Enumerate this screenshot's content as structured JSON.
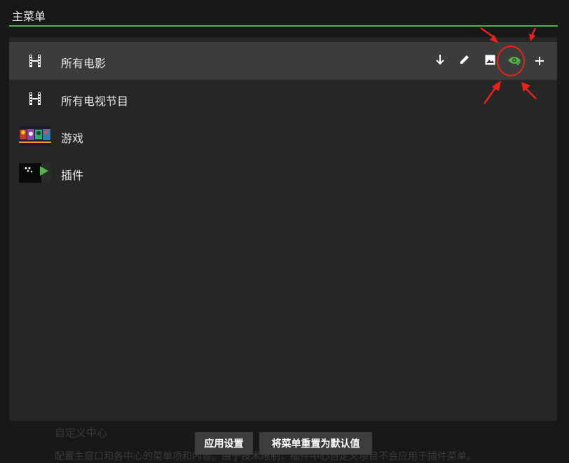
{
  "header": {
    "title": "主菜单"
  },
  "menu_items": [
    {
      "label": "所有电影",
      "icon": "film-icon"
    },
    {
      "label": "所有电视节目",
      "icon": "film-icon"
    },
    {
      "label": "游戏",
      "icon": "games-thumbnail"
    },
    {
      "label": "插件",
      "icon": "addons-thumbnail"
    }
  ],
  "row_actions": [
    "arrow-down-icon",
    "edit-pencil-icon",
    "image-icon",
    "eye-visibility-icon",
    "plus-icon"
  ],
  "background_section": {
    "heading": "自定义中心",
    "description": "配置主窗口和各中心的菜单项和内容。由于技术限制，插件中心自定义项目不会应用于插件菜单。"
  },
  "footer": {
    "apply_label": "应用设置",
    "reset_label": "将菜单重置为默认值"
  },
  "colors": {
    "accent": "#52b54b",
    "annotation": "#e8231c",
    "panel": "#262626",
    "selected_row": "#3c3c3c"
  }
}
